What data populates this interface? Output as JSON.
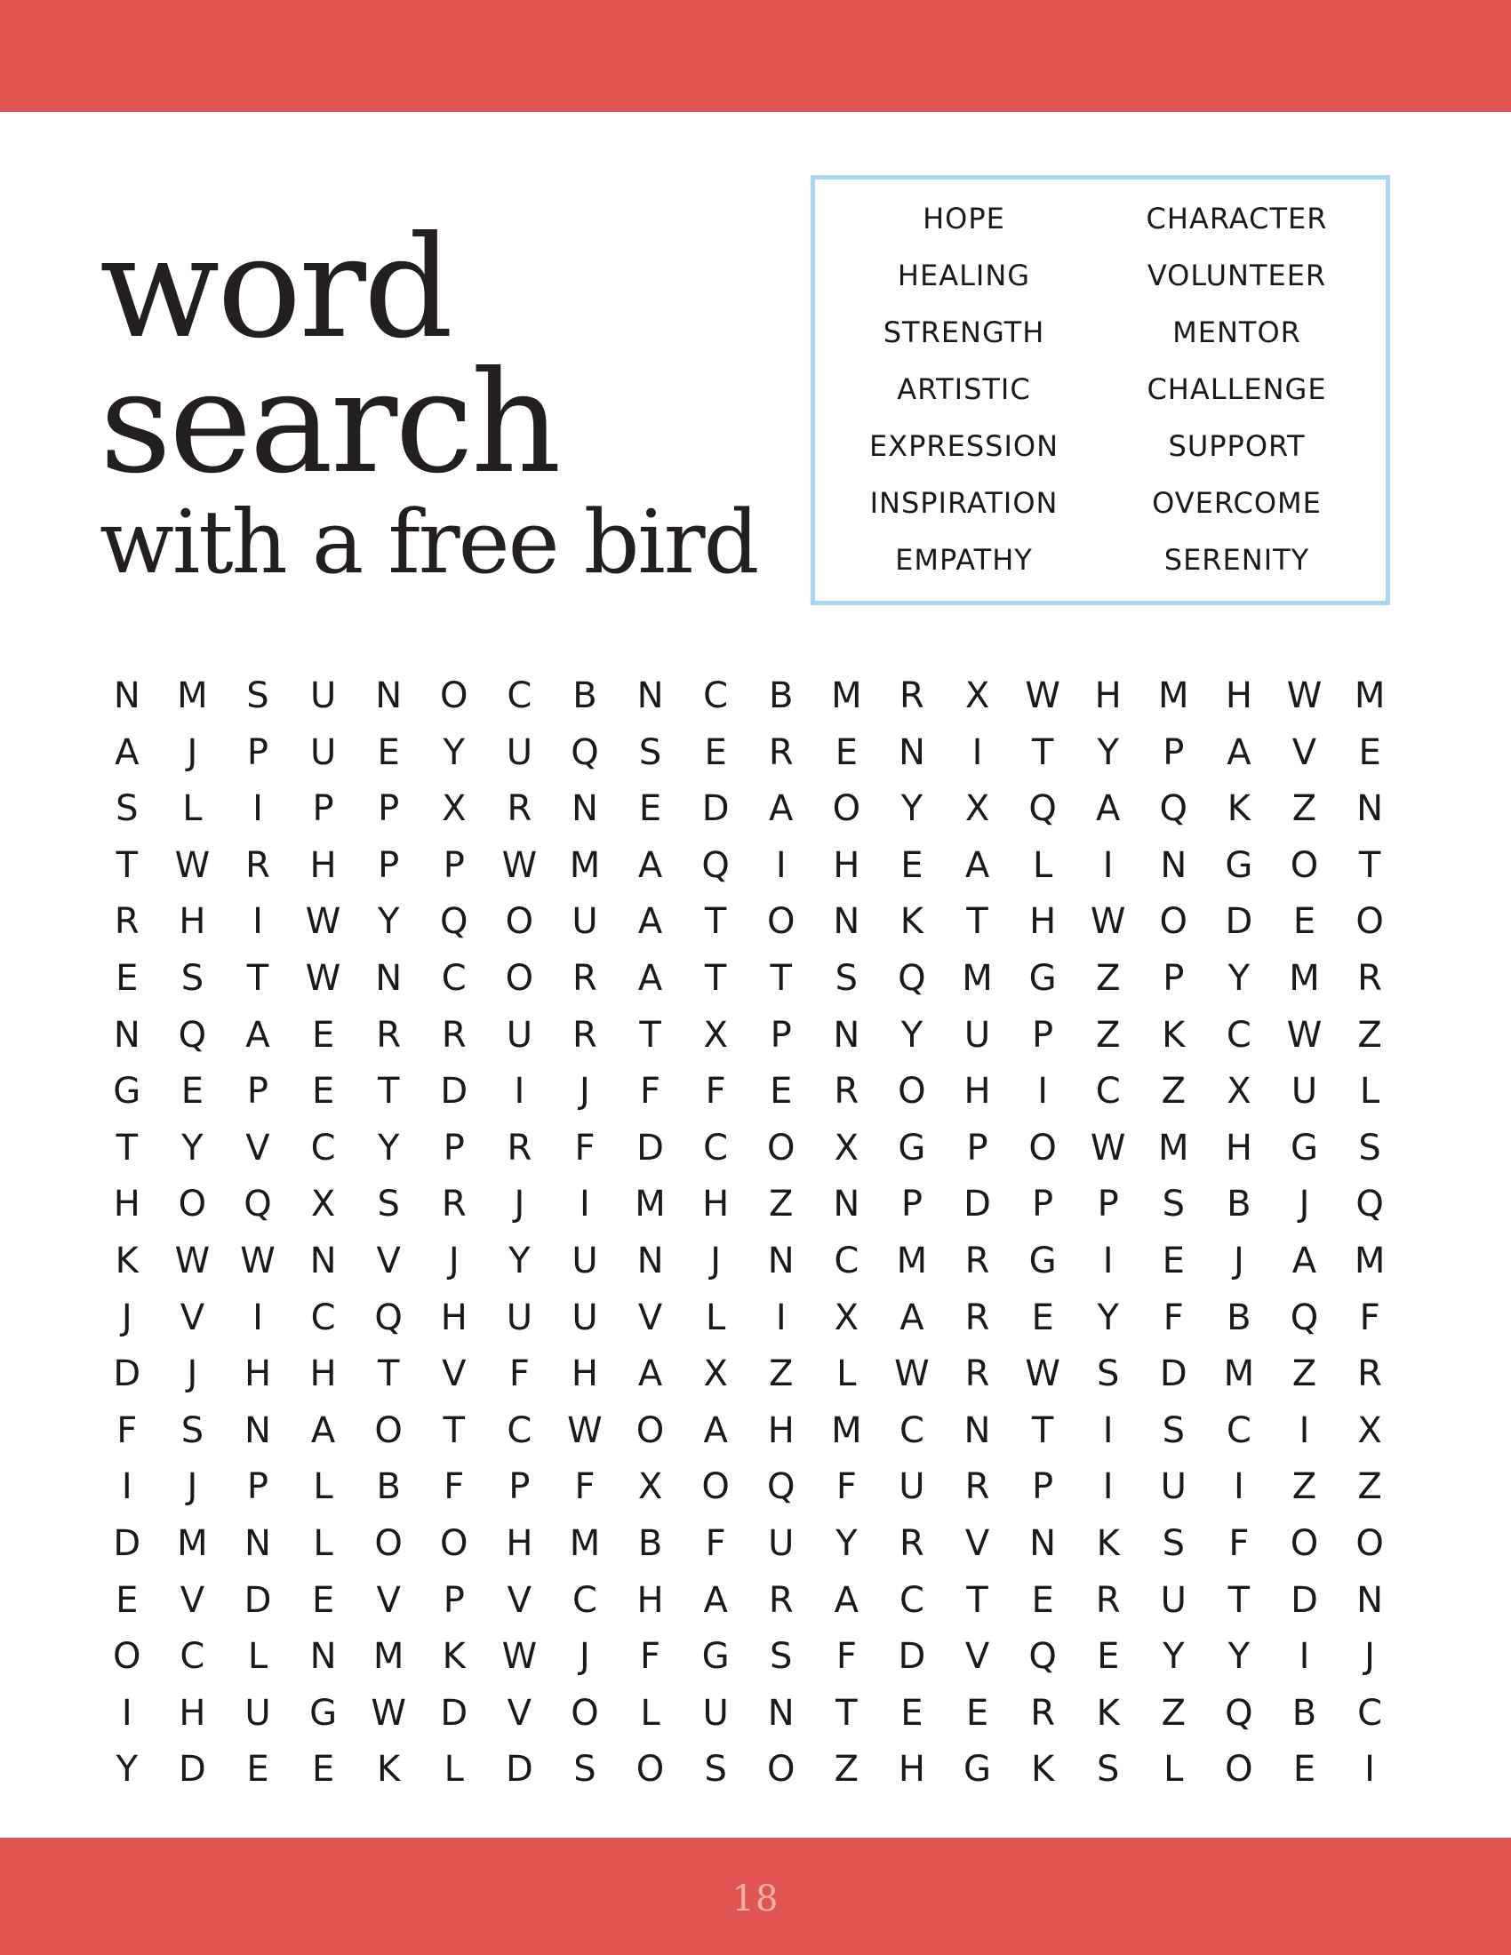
{
  "title": {
    "line1": "word",
    "line2": "search",
    "line3": "with a free bird"
  },
  "word_list": {
    "left": [
      "HOPE",
      "HEALING",
      "STRENGTH",
      "ARTISTIC",
      "EXPRESSION",
      "INSPIRATION",
      "EMPATHY"
    ],
    "right": [
      "CHARACTER",
      "VOLUNTEER",
      "MENTOR",
      "CHALLENGE",
      "SUPPORT",
      "OVERCOME",
      "SERENITY"
    ]
  },
  "grid": [
    "NMSUNOCBNCBMRXWHMHWM",
    "AJPUEYUQSERENITYPAVE",
    "SLIPPXRNEDAOYXQAQKZN",
    "TWRHPPWMAQIHEALINGOT",
    "RHIWYQOUATONKTHWODEO",
    "ESTWNCORATTSQMGZPYMR",
    "NQAERRURTXPNYUPZKCWZ",
    "GEPETDIJFFEROHICZXUL",
    "TYVCYPRFDCOXGPOWMHGS",
    "HOQXSRJIMHZNPDPPSBJQ",
    "KWWNVJYUNJNCMRGIEJAM",
    "JVICQHUUVLIXAREYFBQF",
    "DJHHTVFHAXZLWRWSDMZR",
    "FSNAOTCWOAHMCNTISCIX",
    "IJPLBFPFXOQFURPIUIZZ",
    "DMNLOOHMBFUYRVNKSFOO",
    "EVDEVPVCHARACTERUTDN",
    "OCLNMKWJFGSFDVQEYYIJ",
    "IHUGWDVOLUNTEERKZQBC",
    "YDEEKLDSOSOZHGKSLOEI"
  ],
  "page_number": "18",
  "colors": {
    "band": "#e05552",
    "box_border": "#a8d8ef",
    "text": "#231f20"
  }
}
